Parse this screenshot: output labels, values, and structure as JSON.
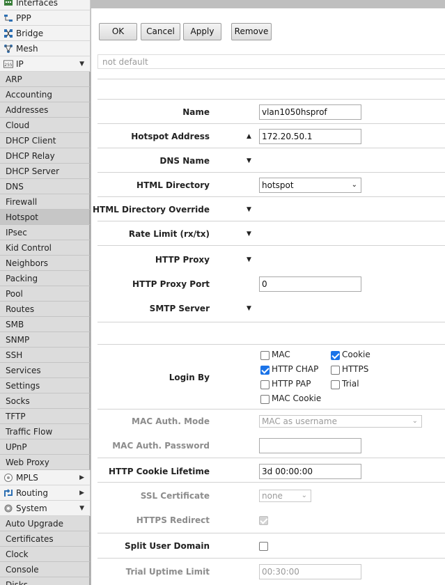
{
  "sidebar": {
    "top_items_a": [
      {
        "label": "Interfaces",
        "icon": "interfaces-icon"
      },
      {
        "label": "PPP",
        "icon": "ppp-icon"
      },
      {
        "label": "Bridge",
        "icon": "bridge-icon"
      },
      {
        "label": "Mesh",
        "icon": "mesh-icon"
      },
      {
        "label": "IP",
        "icon": "ip-icon",
        "arrow": "▼"
      }
    ],
    "ip_items": [
      "ARP",
      "Accounting",
      "Addresses",
      "Cloud",
      "DHCP Client",
      "DHCP Relay",
      "DHCP Server",
      "DNS",
      "Firewall",
      "Hotspot",
      "IPsec",
      "Kid Control",
      "Neighbors",
      "Packing",
      "Pool",
      "Routes",
      "SMB",
      "SNMP",
      "SSH",
      "Services",
      "Settings",
      "Socks",
      "TFTP",
      "Traffic Flow",
      "UPnP",
      "Web Proxy"
    ],
    "active_item": "Hotspot",
    "top_items_b": [
      {
        "label": "MPLS",
        "icon": "mpls-icon",
        "arrow": "▶"
      },
      {
        "label": "Routing",
        "icon": "routing-icon",
        "arrow": "▶"
      },
      {
        "label": "System",
        "icon": "system-icon",
        "arrow": "▼"
      }
    ],
    "system_items": [
      "Auto Upgrade",
      "Certificates",
      "Clock",
      "Console",
      "Disks"
    ]
  },
  "toolbar": {
    "ok": "OK",
    "cancel": "Cancel",
    "apply": "Apply",
    "remove": "Remove"
  },
  "status_text": "not default",
  "form": {
    "name": {
      "label": "Name",
      "value": "vlan1050hsprof"
    },
    "hotspot_address": {
      "label": "Hotspot Address",
      "value": "172.20.50.1"
    },
    "dns_name": {
      "label": "DNS Name"
    },
    "html_directory": {
      "label": "HTML Directory",
      "value": "hotspot"
    },
    "html_directory_override": {
      "label": "HTML Directory Override"
    },
    "rate_limit": {
      "label": "Rate Limit (rx/tx)"
    },
    "http_proxy": {
      "label": "HTTP Proxy"
    },
    "http_proxy_port": {
      "label": "HTTP Proxy Port",
      "value": "0"
    },
    "smtp_server": {
      "label": "SMTP Server"
    },
    "login_by": {
      "label": "Login By",
      "options": [
        {
          "label": "MAC",
          "checked": false
        },
        {
          "label": "Cookie",
          "checked": true
        },
        {
          "label": "HTTP CHAP",
          "checked": true
        },
        {
          "label": "HTTPS",
          "checked": false
        },
        {
          "label": "HTTP PAP",
          "checked": false
        },
        {
          "label": "Trial",
          "checked": false
        },
        {
          "label": "MAC Cookie",
          "checked": false
        }
      ]
    },
    "mac_auth_mode": {
      "label": "MAC Auth. Mode",
      "value": "MAC as username"
    },
    "mac_auth_password": {
      "label": "MAC Auth. Password",
      "value": ""
    },
    "http_cookie_lifetime": {
      "label": "HTTP Cookie Lifetime",
      "value": "3d 00:00:00"
    },
    "ssl_certificate": {
      "label": "SSL Certificate",
      "value": "none"
    },
    "https_redirect": {
      "label": "HTTPS Redirect",
      "checked": true
    },
    "split_user_domain": {
      "label": "Split User Domain",
      "checked": false
    },
    "trial_uptime_limit": {
      "label": "Trial Uptime Limit",
      "value": "00:30:00"
    }
  },
  "colors": {
    "accent": "#1a73e8",
    "sidebar_bg": "#e8e8e8",
    "topbar": "#bfbfbf"
  }
}
